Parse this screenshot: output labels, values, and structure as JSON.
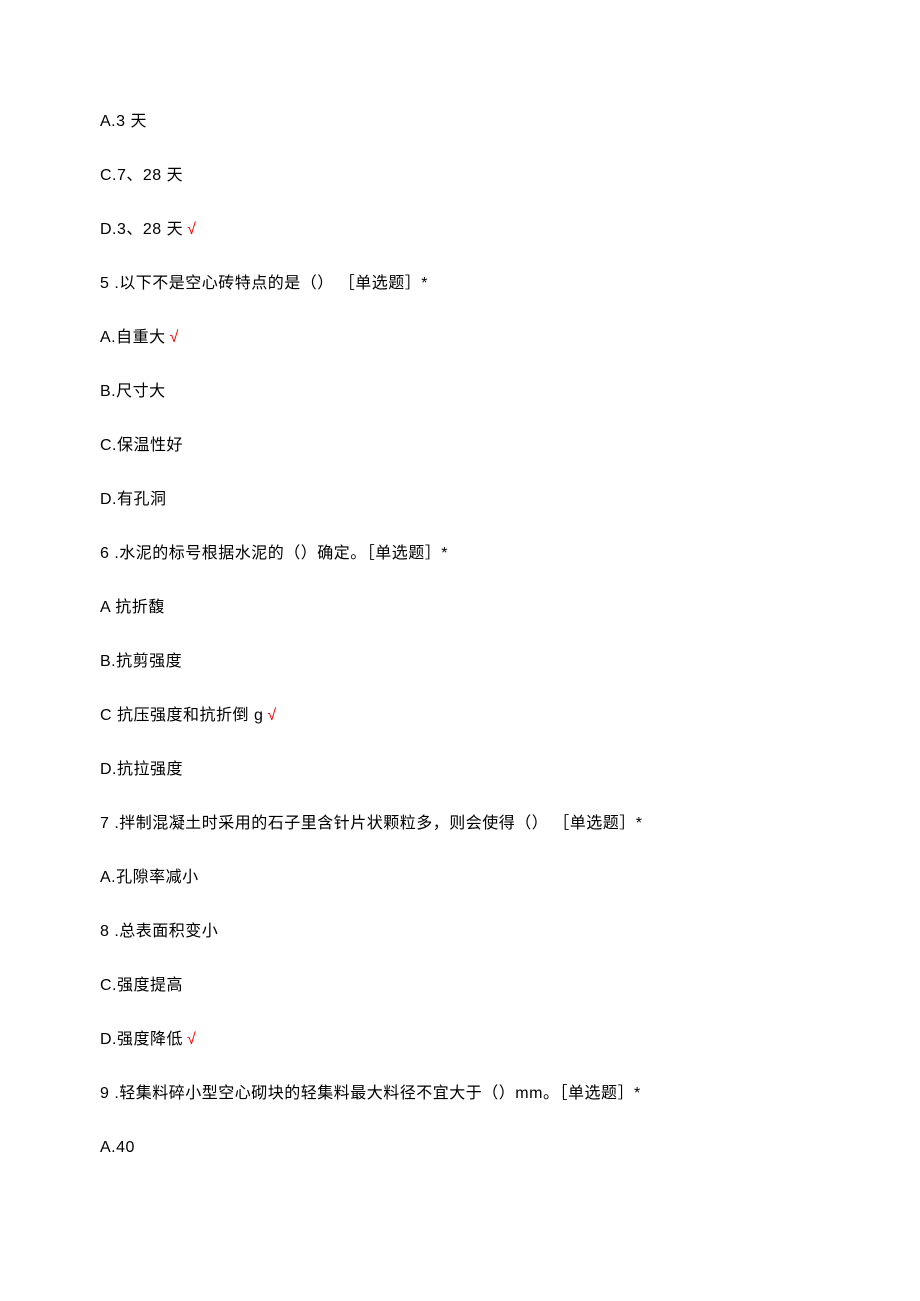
{
  "lines": [
    {
      "text": "A.3 天",
      "correct": false
    },
    {
      "text": "C.7、28 天",
      "correct": false
    },
    {
      "text": "D.3、28 天",
      "correct": true
    },
    {
      "text": "5   .以下不是空心砖特点的是（） ［单选题］*",
      "correct": false
    },
    {
      "text": "A.自重大",
      "correct": true
    },
    {
      "text": "B.尺寸大",
      "correct": false
    },
    {
      "text": "C.保温性好",
      "correct": false
    },
    {
      "text": "D.有孔洞",
      "correct": false
    },
    {
      "text": "6   .水泥的标号根据水泥的（）确定。［单选题］*",
      "correct": false
    },
    {
      "text": "A 抗折馥",
      "correct": false
    },
    {
      "text": "B.抗剪强度",
      "correct": false
    },
    {
      "text": "C 抗压强度和抗折倒 g",
      "correct": true
    },
    {
      "text": "D.抗拉强度",
      "correct": false
    },
    {
      "text": "7   .拌制混凝土时采用的石子里含针片状颗粒多，则会使得（） ［单选题］*",
      "correct": false
    },
    {
      "text": "A.孔隙率减小",
      "correct": false
    },
    {
      "text": "8   .总表面积变小",
      "correct": false
    },
    {
      "text": "C.强度提高",
      "correct": false
    },
    {
      "text": "D.强度降低",
      "correct": true
    },
    {
      "text": "9   .轻集料碎小型空心砌块的轻集料最大料径不宜大于（）mm。［单选题］*",
      "correct": false
    },
    {
      "text": "A.40",
      "correct": false
    }
  ],
  "checkmark": "√"
}
